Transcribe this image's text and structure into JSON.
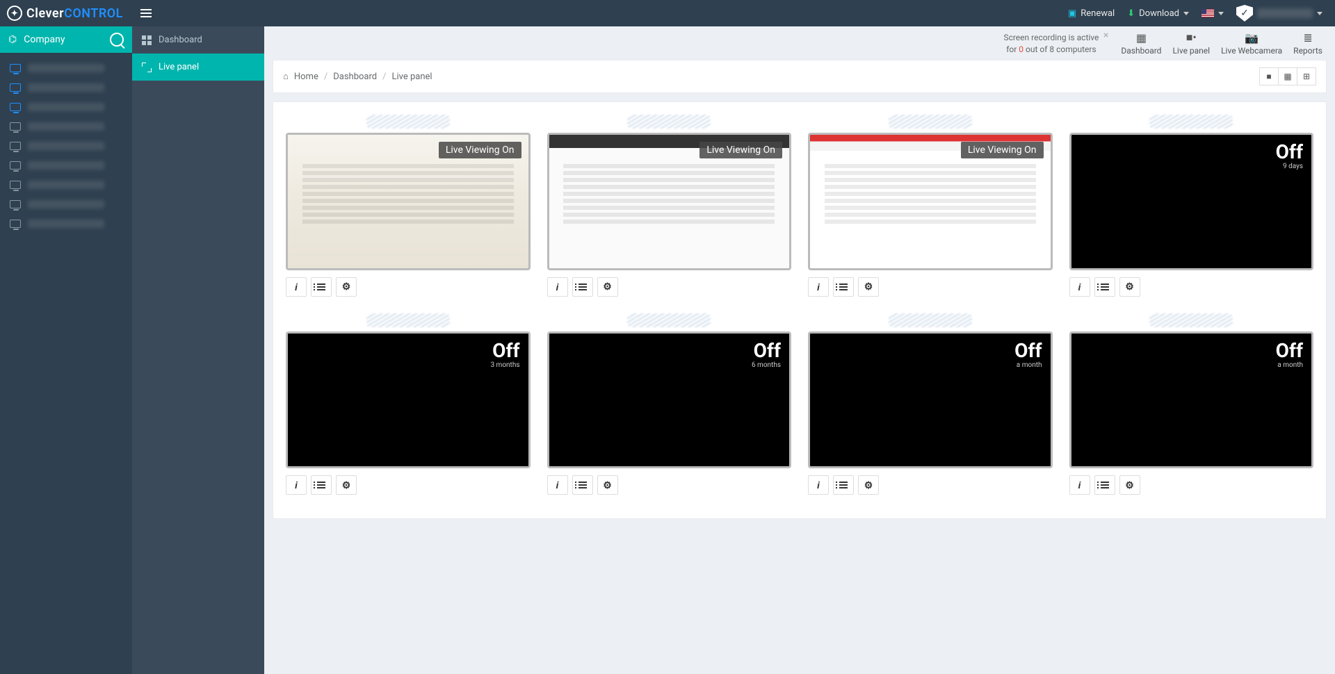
{
  "app": {
    "logo_text_1": "Clever",
    "logo_text_2": "CONTROL"
  },
  "topbar": {
    "renewal": "Renewal",
    "download": "Download",
    "user_label": ""
  },
  "sidebar1": {
    "company_label": "Company",
    "computers": [
      {
        "online": true,
        "label": ""
      },
      {
        "online": true,
        "label": ""
      },
      {
        "online": true,
        "label": ""
      },
      {
        "online": false,
        "label": ""
      },
      {
        "online": false,
        "label": ""
      },
      {
        "online": false,
        "label": ""
      },
      {
        "online": false,
        "label": ""
      },
      {
        "online": false,
        "label": ""
      },
      {
        "online": false,
        "label": ""
      }
    ]
  },
  "sidebar2": {
    "dashboard": "Dashboard",
    "live_panel": "Live panel"
  },
  "toolbar": {
    "notice_line1": "Screen recording is active",
    "notice_line2_a": "for ",
    "notice_count": "0",
    "notice_line2_b": " out of 8 computers",
    "dashboard": "Dashboard",
    "live_panel": "Live panel",
    "live_webcamera": "Live Webcamera",
    "reports": "Reports"
  },
  "breadcrumb": {
    "home": "Home",
    "dashboard": "Dashboard",
    "current": "Live panel"
  },
  "panels": [
    {
      "status": "Live Viewing On",
      "style": "light",
      "off": false,
      "sub": ""
    },
    {
      "status": "Live Viewing On",
      "style": "browser",
      "off": false,
      "sub": ""
    },
    {
      "status": "Live Viewing On",
      "style": "excel",
      "off": false,
      "sub": ""
    },
    {
      "status": "Off",
      "style": "black",
      "off": true,
      "sub": "9 days"
    },
    {
      "status": "Off",
      "style": "black",
      "off": true,
      "sub": "3 months"
    },
    {
      "status": "Off",
      "style": "black",
      "off": true,
      "sub": "6 months"
    },
    {
      "status": "Off",
      "style": "black",
      "off": true,
      "sub": "a month"
    },
    {
      "status": "Off",
      "style": "black",
      "off": true,
      "sub": "a month"
    }
  ]
}
